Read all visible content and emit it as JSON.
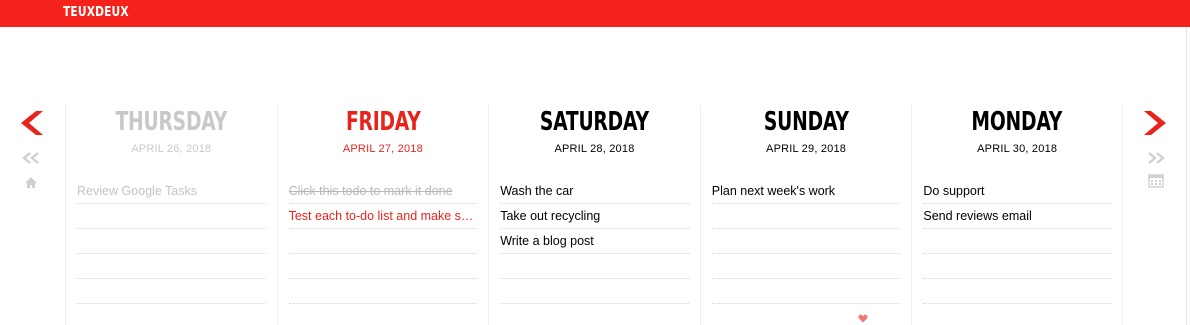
{
  "app": {
    "brand": "TEUXDEUX"
  },
  "colors": {
    "brand_red": "#f5221b",
    "today_red": "#e8231b",
    "past_gray": "#c8c8c8"
  },
  "nav": {
    "left": {
      "prev_icon": "chevron-left-icon",
      "fast_prev_icon": "double-chevron-left-icon",
      "home_icon": "home-icon"
    },
    "right": {
      "next_icon": "chevron-right-icon",
      "fast_next_icon": "double-chevron-right-icon",
      "calendar_icon": "calendar-icon"
    }
  },
  "days": [
    {
      "name": "THURSDAY",
      "date": "APRIL 26, 2018",
      "state": "past",
      "todos": [
        {
          "text": "Review Google Tasks",
          "done": false
        },
        {
          "text": ""
        },
        {
          "text": ""
        },
        {
          "text": ""
        },
        {
          "text": ""
        }
      ]
    },
    {
      "name": "FRIDAY",
      "date": "APRIL 27, 2018",
      "state": "today",
      "todos": [
        {
          "text": "Click this todo to mark it done",
          "done": true
        },
        {
          "text": "Test each to-do list and make su...",
          "active": true
        },
        {
          "text": ""
        },
        {
          "text": ""
        },
        {
          "text": ""
        }
      ]
    },
    {
      "name": "SATURDAY",
      "date": "APRIL 28, 2018",
      "state": "future",
      "todos": [
        {
          "text": "Wash the car"
        },
        {
          "text": "Take out recycling"
        },
        {
          "text": "Write a blog post"
        },
        {
          "text": ""
        },
        {
          "text": ""
        }
      ]
    },
    {
      "name": "SUNDAY",
      "date": "APRIL 29, 2018",
      "state": "future",
      "todos": [
        {
          "text": "Plan next week's work"
        },
        {
          "text": ""
        },
        {
          "text": ""
        },
        {
          "text": ""
        },
        {
          "text": ""
        }
      ]
    },
    {
      "name": "MONDAY",
      "date": "APRIL 30, 2018",
      "state": "future",
      "todos": [
        {
          "text": "Do support"
        },
        {
          "text": "Send reviews email"
        },
        {
          "text": ""
        },
        {
          "text": ""
        },
        {
          "text": ""
        }
      ]
    }
  ],
  "footer": {
    "heart_icon": "heart-icon"
  }
}
